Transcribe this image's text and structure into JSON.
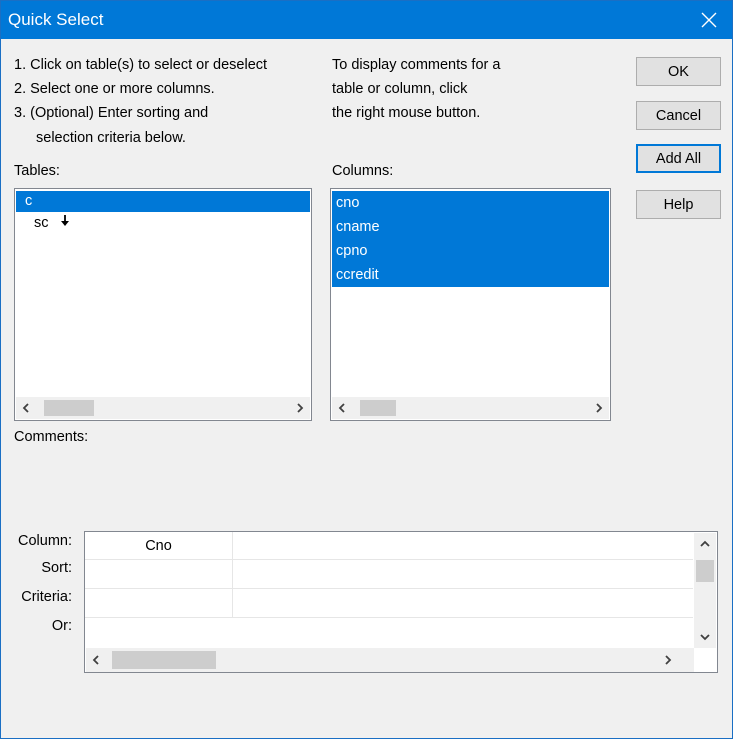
{
  "window": {
    "title": "Quick Select"
  },
  "instructions": {
    "steps": [
      "1. Click on table(s) to select or deselect",
      "2. Select one or more columns.",
      "3. (Optional) Enter sorting and",
      "selection criteria below."
    ],
    "comment_hint": [
      "To display comments for a",
      "table or column, click",
      "the right mouse button."
    ]
  },
  "buttons": {
    "ok": "OK",
    "cancel": "Cancel",
    "add_all": "Add All",
    "help": "Help"
  },
  "tables": {
    "label": "Tables:",
    "items": [
      "c",
      "sc"
    ],
    "selected": "c"
  },
  "columns": {
    "label": "Columns:",
    "items": [
      "cno",
      "cname",
      "cpno",
      "ccredit"
    ]
  },
  "comments": {
    "label": "Comments:"
  },
  "criteria_grid": {
    "row_labels": [
      "Column:",
      "Sort:",
      "Criteria:",
      "Or:"
    ],
    "column_values": [
      "Cno"
    ]
  },
  "icons": {
    "close": "close-icon",
    "scroll_left": "chevron-left-icon",
    "scroll_right": "chevron-right-icon",
    "scroll_up": "chevron-up-icon",
    "scroll_down": "chevron-down-icon",
    "expand": "down-arrow-icon"
  },
  "colors": {
    "accent": "#0078d7",
    "titlebar": "#0078d7",
    "selection": "#0078d7"
  }
}
